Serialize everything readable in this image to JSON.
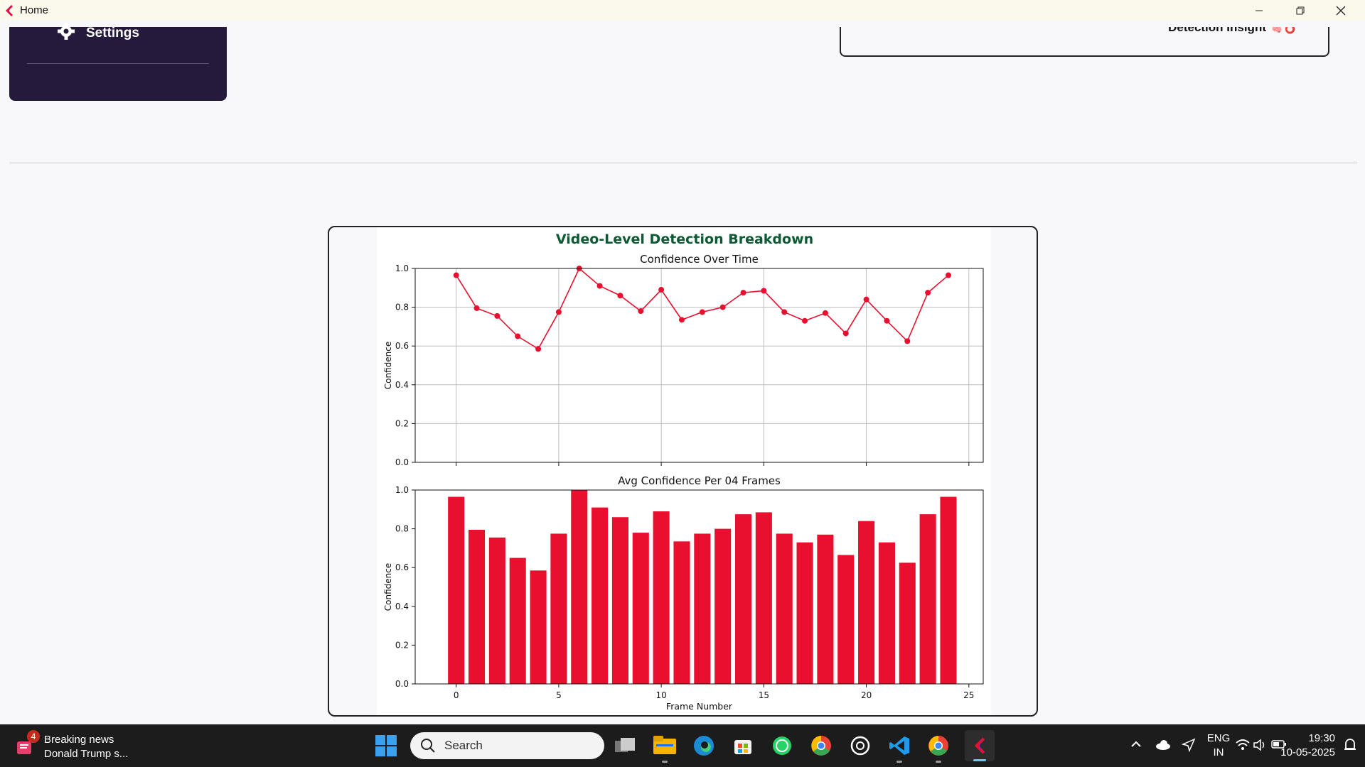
{
  "window": {
    "title": "Home",
    "controls": {
      "minimize": "—",
      "restore": "❐",
      "close": "✕"
    }
  },
  "sidebar": {
    "settings_label": "Settings"
  },
  "insight_card": {
    "label": "Detection Insight"
  },
  "colors": {
    "accent": "#e8102e",
    "title_green": "#0b5a33",
    "sidebar_bg": "#251a3b",
    "taskbar_bg": "#1c1c1c"
  },
  "chart_data": [
    {
      "type": "line",
      "suptitle": "Video-Level Detection Breakdown",
      "title": "Confidence Over Time",
      "xlabel": "",
      "ylabel": "Confidence",
      "x": [
        0,
        1,
        2,
        3,
        4,
        5,
        6,
        7,
        8,
        9,
        10,
        11,
        12,
        13,
        14,
        15,
        16,
        17,
        18,
        19,
        20,
        21,
        22,
        23,
        24
      ],
      "values": [
        0.965,
        0.795,
        0.755,
        0.65,
        0.585,
        0.775,
        1.0,
        0.91,
        0.86,
        0.78,
        0.89,
        0.735,
        0.775,
        0.8,
        0.875,
        0.885,
        0.775,
        0.73,
        0.77,
        0.665,
        0.84,
        0.73,
        0.625,
        0.875,
        0.965
      ],
      "xlim": [
        -2,
        25.7
      ],
      "ylim": [
        0,
        1.0
      ],
      "xticks": [
        0,
        5,
        10,
        15,
        20,
        25
      ],
      "yticks": [
        "0.0",
        "0.2",
        "0.4",
        "0.6",
        "0.8",
        "1.0"
      ],
      "grid": true
    },
    {
      "type": "bar",
      "title": "Avg Confidence Per 04 Frames",
      "xlabel": "Frame Number",
      "ylabel": "Confidence",
      "x": [
        0,
        1,
        2,
        3,
        4,
        5,
        6,
        7,
        8,
        9,
        10,
        11,
        12,
        13,
        14,
        15,
        16,
        17,
        18,
        19,
        20,
        21,
        22,
        23,
        24
      ],
      "values": [
        0.965,
        0.795,
        0.755,
        0.65,
        0.585,
        0.775,
        1.0,
        0.91,
        0.86,
        0.78,
        0.89,
        0.735,
        0.775,
        0.8,
        0.875,
        0.885,
        0.775,
        0.73,
        0.77,
        0.665,
        0.84,
        0.73,
        0.625,
        0.875,
        0.965
      ],
      "xlim": [
        -2,
        25.7
      ],
      "ylim": [
        0,
        1.0
      ],
      "xticks": [
        "0",
        "5",
        "10",
        "15",
        "20",
        "25"
      ],
      "yticks": [
        "0.0",
        "0.2",
        "0.4",
        "0.6",
        "0.8",
        "1.0"
      ],
      "grid": false
    }
  ],
  "taskbar": {
    "news_count": "4",
    "news_title": "Breaking news",
    "news_sub": "Donald Trump s...",
    "search_placeholder": "Search",
    "lang_top": "ENG",
    "lang_bottom": "IN",
    "time": "19:30",
    "date": "10-05-2025"
  }
}
